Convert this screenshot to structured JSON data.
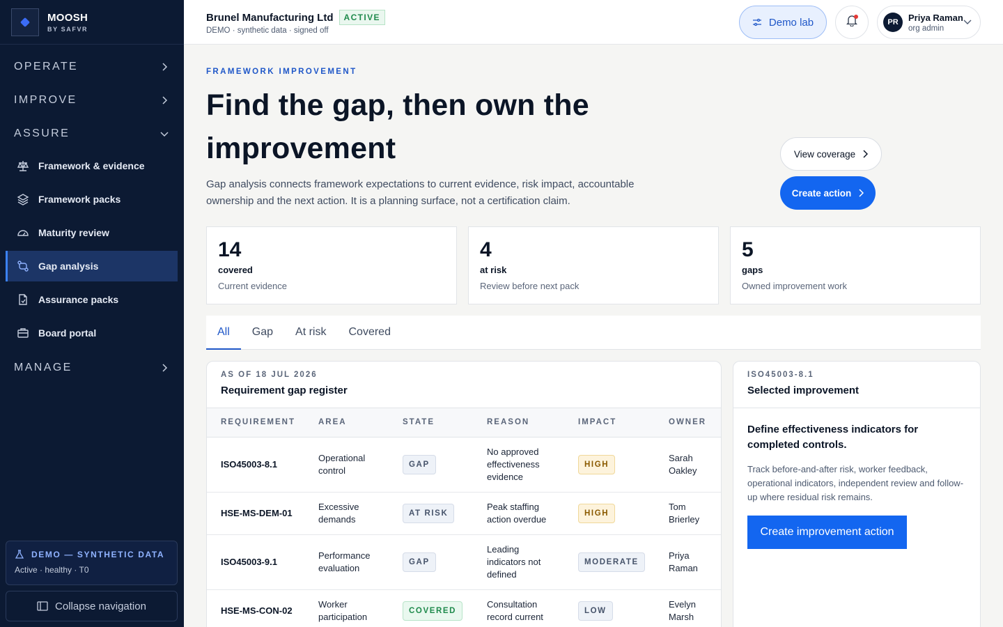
{
  "brand": {
    "name": "MOOSH",
    "sub": "BY SAFVR"
  },
  "nav": {
    "sections": {
      "operate": "OPERATE",
      "improve": "IMPROVE",
      "assure": "ASSURE",
      "manage": "MANAGE"
    },
    "items": [
      {
        "label": "Framework & evidence",
        "icon": "scale-icon"
      },
      {
        "label": "Framework packs",
        "icon": "layers-icon"
      },
      {
        "label": "Maturity review",
        "icon": "gauge-icon"
      },
      {
        "label": "Gap analysis",
        "icon": "route-icon"
      },
      {
        "label": "Assurance packs",
        "icon": "document-check-icon"
      },
      {
        "label": "Board portal",
        "icon": "briefcase-icon"
      }
    ],
    "active_item": "Gap analysis",
    "demo_title": "DEMO — SYNTHETIC DATA",
    "demo_status": "Active · healthy · T0",
    "collapse_label": "Collapse navigation"
  },
  "header": {
    "org_name": "Brunel Manufacturing Ltd",
    "org_status": "ACTIVE",
    "org_sub": "DEMO · synthetic data · signed off",
    "demo_lab": "Demo lab",
    "user_initials": "PR",
    "user_name": "Priya Raman",
    "user_role": "org admin"
  },
  "hero": {
    "eyebrow": "FRAMEWORK IMPROVEMENT",
    "title": "Find the gap, then own the improvement",
    "lede": "Gap analysis connects framework expectations to current evidence, risk impact, accountable ownership and the next action. It is a planning surface, not a certification claim.",
    "view_coverage": "View coverage",
    "create_action": "Create action"
  },
  "stats": [
    {
      "value": "14",
      "label": "covered",
      "note": "Current evidence"
    },
    {
      "value": "4",
      "label": "at risk",
      "note": "Review before next pack"
    },
    {
      "value": "5",
      "label": "gaps",
      "note": "Owned improvement work"
    }
  ],
  "tabs": [
    "All",
    "Gap",
    "At risk",
    "Covered"
  ],
  "register": {
    "as_of": "AS OF 18 JUL 2026",
    "title": "Requirement gap register",
    "columns": [
      "REQUIREMENT",
      "AREA",
      "STATE",
      "REASON",
      "IMPACT",
      "OWNER"
    ],
    "rows": [
      {
        "requirement": "ISO45003-8.1",
        "area": "Operational control",
        "state": "GAP",
        "reason": "No approved effectiveness evidence",
        "impact": "HIGH",
        "owner": "Sarah Oakley"
      },
      {
        "requirement": "HSE-MS-DEM-01",
        "area": "Excessive demands",
        "state": "AT RISK",
        "reason": "Peak staffing action overdue",
        "impact": "HIGH",
        "owner": "Tom Brierley"
      },
      {
        "requirement": "ISO45003-9.1",
        "area": "Performance evaluation",
        "state": "GAP",
        "reason": "Leading indicators not defined",
        "impact": "MODERATE",
        "owner": "Priya Raman"
      },
      {
        "requirement": "HSE-MS-CON-02",
        "area": "Worker participation",
        "state": "COVERED",
        "reason": "Consultation record current",
        "impact": "LOW",
        "owner": "Evelyn Marsh"
      }
    ]
  },
  "selected": {
    "requirement": "ISO45003-8.1",
    "title": "Selected improvement",
    "heading": "Define effectiveness indicators for completed controls.",
    "description": "Track before-and-after risk, worker feedback, operational indicators, independent review and follow-up where residual risk remains.",
    "button": "Create improvement action"
  },
  "colors": {
    "sidebar": "#0c1a33",
    "accent": "#1366f0",
    "active_nav": "#1c3566"
  }
}
